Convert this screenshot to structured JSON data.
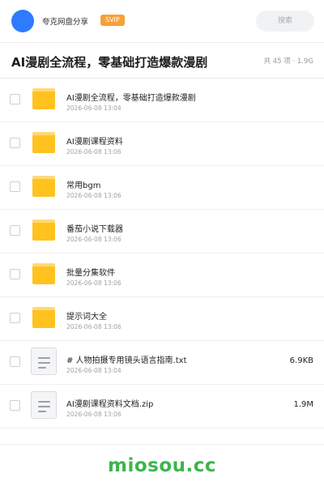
{
  "header": {
    "user_name": "夸克网盘分享",
    "badge": "SVIP",
    "search_placeholder": "搜索",
    "avatar_color": "#2f7bff",
    "badge_color": "#f7a03a"
  },
  "title_bar": {
    "title": "AI漫剧全流程，零基础打造爆款漫剧",
    "summary": "共 45 项 · 1.9G"
  },
  "files": [
    {
      "name": "AI漫剧全流程，零基础打造爆款漫剧",
      "date": "2026-06-08 13:04",
      "size": "",
      "icon": "folder-icon"
    },
    {
      "name": "AI漫剧课程资料",
      "date": "2026-06-08 13:06",
      "size": "",
      "icon": "folder-icon"
    },
    {
      "name": "常用bgm",
      "date": "2026-06-08 13:06",
      "size": "",
      "icon": "folder-icon"
    },
    {
      "name": "番茄小说下载器",
      "date": "2026-06-08 13:06",
      "size": "",
      "icon": "folder-icon"
    },
    {
      "name": "批量分集软件",
      "date": "2026-06-08 13:06",
      "size": "",
      "icon": "folder-icon"
    },
    {
      "name": "提示词大全",
      "date": "2026-06-08 13:06",
      "size": "",
      "icon": "folder-icon"
    },
    {
      "name": "# 人物拍摄专用镜头语言指南.txt",
      "date": "2026-06-08 13:04",
      "size": "6.9KB",
      "icon": "document-icon"
    },
    {
      "name": "AI漫剧课程资料文档.zip",
      "date": "2026-06-08 13:06",
      "size": "1.9M",
      "icon": "document-icon"
    }
  ],
  "watermark": "miosou.cc",
  "colors": {
    "folder": "#ffc21f",
    "watermark": "#3cb64a"
  }
}
